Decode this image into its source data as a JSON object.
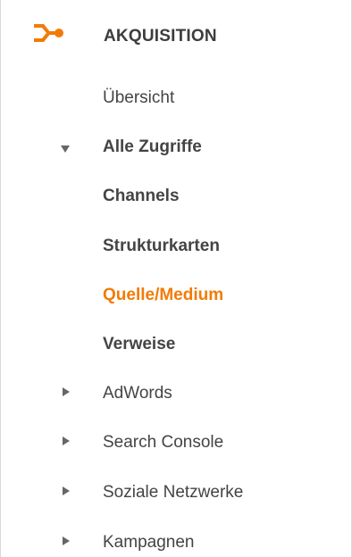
{
  "section": {
    "icon": "acquisition-icon",
    "title": "AKQUISITION",
    "accent_color": "#f27b07"
  },
  "items": {
    "overview": "Übersicht",
    "all_traffic": {
      "label": "Alle Zugriffe",
      "expanded": true,
      "children": [
        "Channels",
        "Strukturkarten",
        "Quelle/Medium",
        "Verweise"
      ],
      "active_child": "Quelle/Medium"
    },
    "adwords": "AdWords",
    "search_console": "Search Console",
    "social": "Soziale Netzwerke",
    "campaigns": "Kampagnen"
  }
}
